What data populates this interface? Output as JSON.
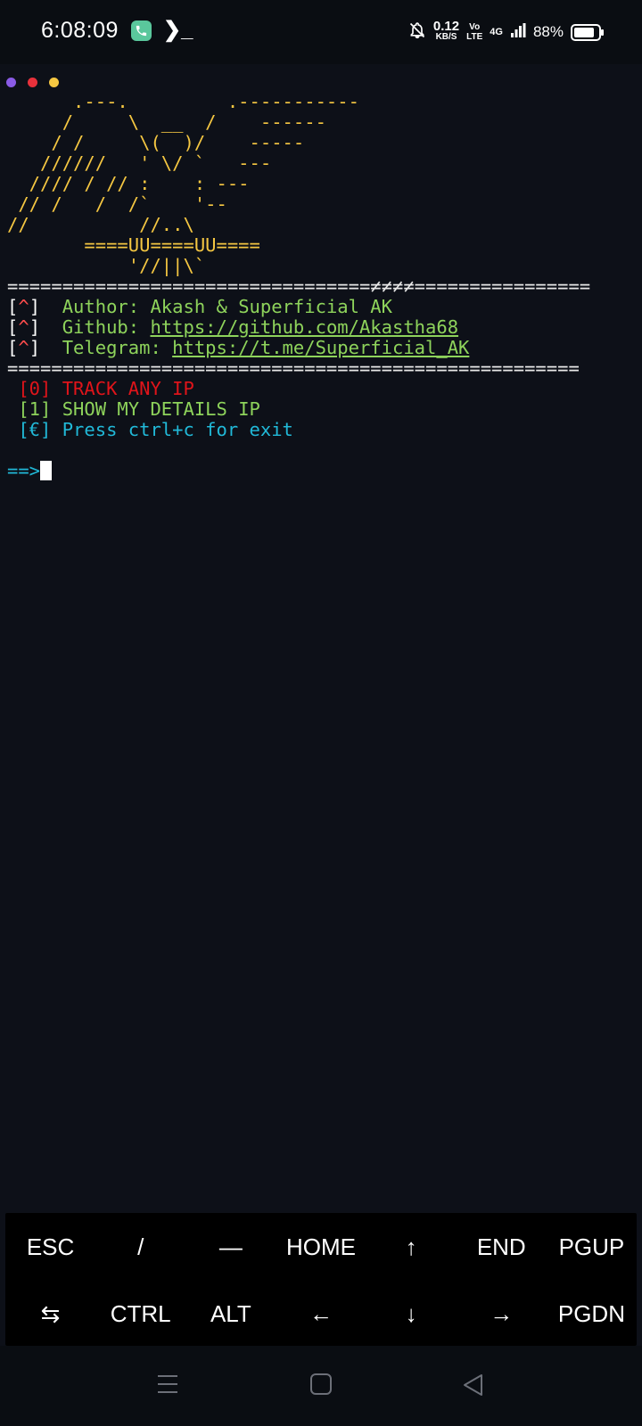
{
  "status_bar": {
    "time": "6:08:09",
    "terminal_glyph": "❯_",
    "speed_value": "0.12",
    "speed_unit": "KB/S",
    "volte_top": "Vo",
    "volte_bottom": "LTE",
    "network": "4G",
    "battery": "88%"
  },
  "window_dots": [
    "#8a5be6",
    "#e8313b",
    "#f5c742"
  ],
  "terminal": {
    "art": [
      "      .---.         .-----------",
      "     /     \\  __  /    ------",
      "    / /     \\(  )/    -----",
      "   //////   ' \\/ `   ---",
      "  //// / // :    : ---",
      " // /   /  /`    '--",
      "//          //..\\",
      "       ====UU====UU====",
      "           '//||\\`"
    ],
    "separator_top": "=================================≠≠≠≠================",
    "author_marker": "^",
    "author_label": "Author: ",
    "author_value": "Akash & Superficial AK",
    "github_label": "Github: ",
    "github_url": "https://github.com/Akastha68",
    "telegram_label": "Telegram: ",
    "telegram_url": "https://t.me/Superficial_AK",
    "separator_bottom": "====================================================",
    "options": [
      {
        "key": "[0]",
        "label": "TRACK ANY IP"
      },
      {
        "key": "[1]",
        "label": "SHOW MY DETAILS IP"
      },
      {
        "key": "[€]",
        "label": "Press ctrl+c for exit"
      }
    ],
    "prompt": "==>"
  },
  "extra_keys": {
    "row1": [
      "ESC",
      "/",
      "—",
      "HOME",
      "↑",
      "END",
      "PGUP"
    ],
    "row2": [
      "⇆",
      "CTRL",
      "ALT",
      "←",
      "↓",
      "→",
      "PGDN"
    ]
  }
}
